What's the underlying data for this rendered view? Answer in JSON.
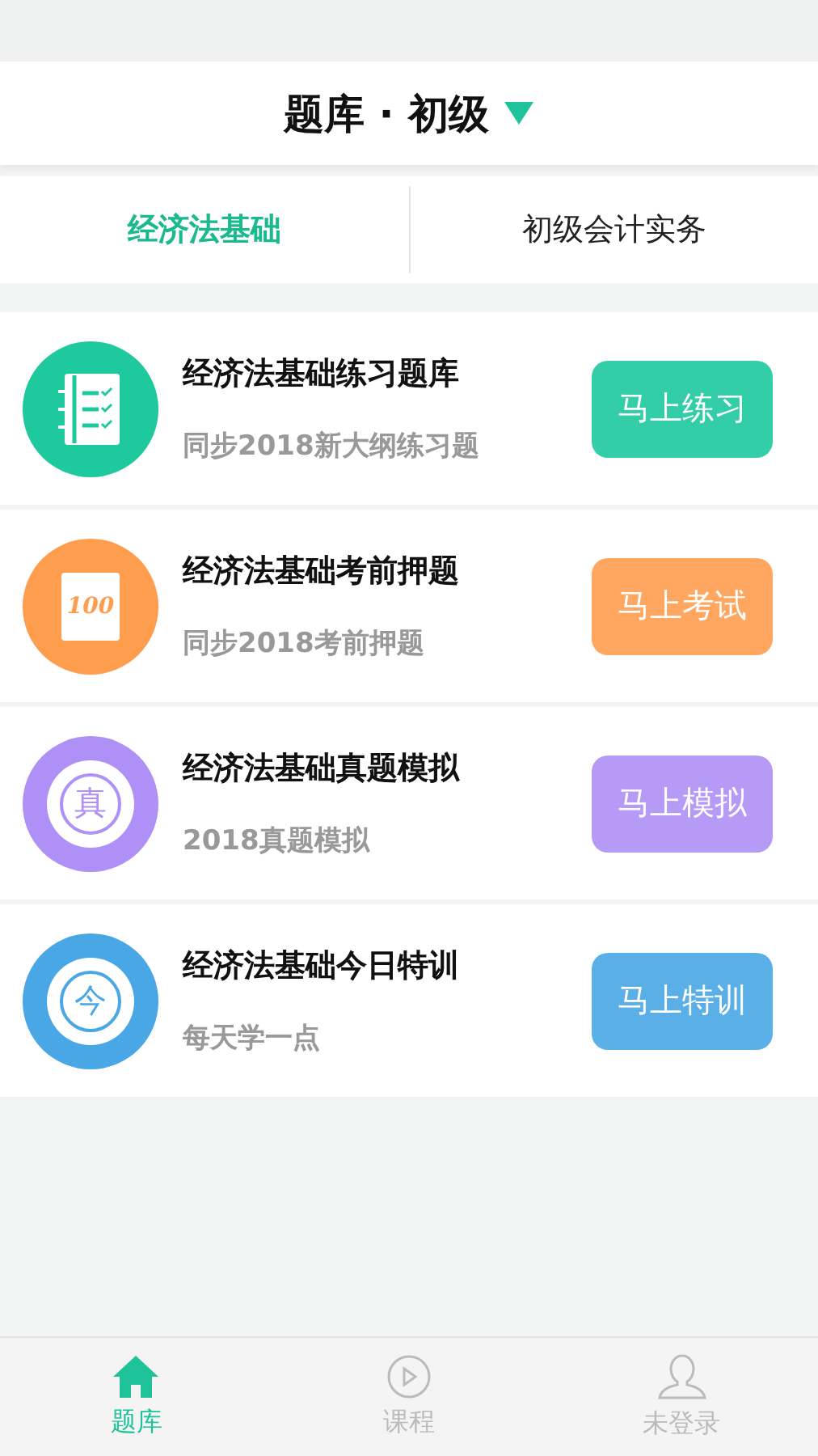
{
  "header": {
    "title": "题库 · 初级"
  },
  "tabs": [
    {
      "label": "经济法基础",
      "selected": true
    },
    {
      "label": "初级会计实务",
      "selected": false
    }
  ],
  "items": [
    {
      "kind": "notebook",
      "title": "经济法基础练习题库",
      "subtitle": "同步2018新大纲练习题",
      "button": "马上练习",
      "color": "#1ec99e"
    },
    {
      "kind": "score",
      "glyph": "100",
      "title": "经济法基础考前押题",
      "subtitle": "同步2018考前押题",
      "button": "马上考试",
      "color": "#ff9d4f"
    },
    {
      "kind": "seal",
      "glyph": "真",
      "title": "经济法基础真题模拟",
      "subtitle": "2018真题模拟",
      "button": "马上模拟",
      "color": "#ae90f6"
    },
    {
      "kind": "seal",
      "glyph": "今",
      "title": "经济法基础今日特训",
      "subtitle": "每天学一点",
      "button": "马上特训",
      "color": "#4aa7e5"
    }
  ],
  "nav": [
    {
      "kind": "home",
      "label": "题库",
      "selected": true
    },
    {
      "kind": "play",
      "label": "课程",
      "selected": false
    },
    {
      "kind": "user",
      "label": "未登录",
      "selected": false
    }
  ]
}
